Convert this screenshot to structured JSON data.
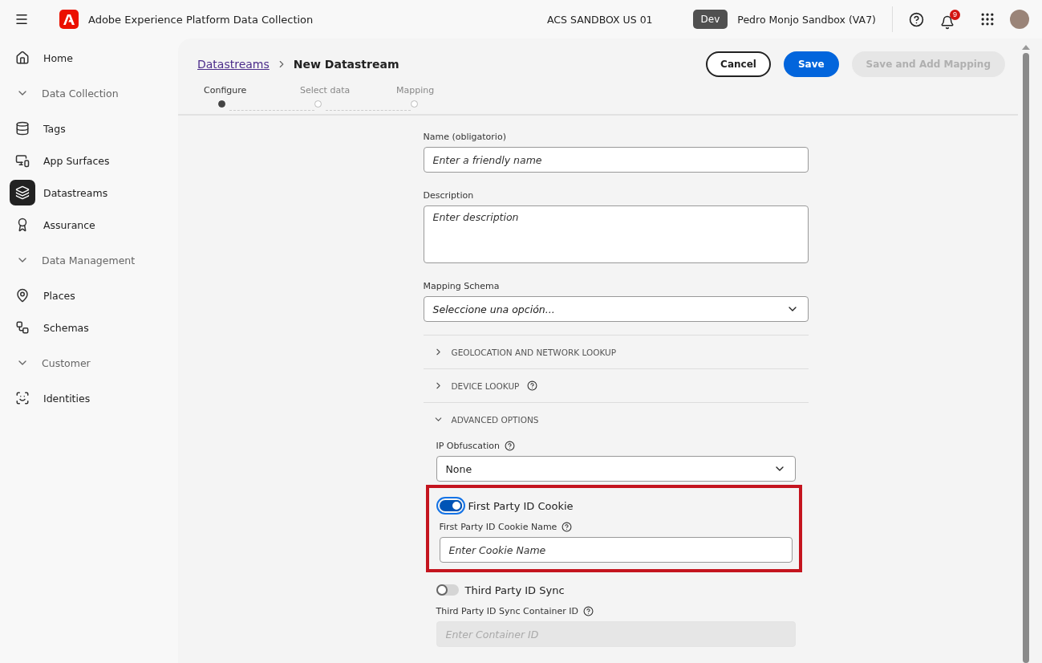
{
  "app_bar": {
    "title": "Adobe Experience Platform Data Collection",
    "org": "ACS SANDBOX US 01",
    "env_badge": "Dev",
    "sandbox": "Pedro Monjo Sandbox (VA7)",
    "notification_count": "9"
  },
  "sidebar": {
    "items": [
      {
        "kind": "item",
        "label": "Home",
        "selected": false
      },
      {
        "kind": "group",
        "label": "Data Collection",
        "expanded": true
      },
      {
        "kind": "item",
        "label": "Tags",
        "selected": false
      },
      {
        "kind": "item",
        "label": "App Surfaces",
        "selected": false
      },
      {
        "kind": "item",
        "label": "Datastreams",
        "selected": true
      },
      {
        "kind": "item",
        "label": "Assurance",
        "selected": false
      },
      {
        "kind": "group",
        "label": "Data Management",
        "expanded": true
      },
      {
        "kind": "item",
        "label": "Places",
        "selected": false
      },
      {
        "kind": "item",
        "label": "Schemas",
        "selected": false
      },
      {
        "kind": "group",
        "label": "Customer",
        "expanded": true
      },
      {
        "kind": "item",
        "label": "Identities",
        "selected": false
      }
    ]
  },
  "breadcrumb": {
    "link": "Datastreams",
    "current": "New Datastream"
  },
  "actions": [
    {
      "label": "Cancel",
      "kind": "secondary",
      "disabled": false
    },
    {
      "label": "Save",
      "kind": "primary",
      "disabled": false
    },
    {
      "label": "Save and Add Mapping",
      "kind": "secondary",
      "disabled": true
    }
  ],
  "steps": [
    {
      "label": "Configure",
      "selected": true
    },
    {
      "label": "Select data",
      "selected": false
    },
    {
      "label": "Mapping",
      "selected": false
    }
  ],
  "form": {
    "name": {
      "label": "Name (obligatorio)",
      "placeholder": "Enter a friendly name"
    },
    "description": {
      "label": "Description",
      "placeholder": "Enter description"
    },
    "mapping_schema": {
      "label": "Mapping Schema",
      "value": "Seleccione una opción..."
    }
  },
  "sections": [
    {
      "title": "GEOLOCATION AND NETWORK LOOKUP",
      "expanded": false,
      "help": false
    },
    {
      "title": "DEVICE LOOKUP",
      "expanded": false,
      "help": true
    },
    {
      "title": "ADVANCED OPTIONS",
      "expanded": true,
      "help": false
    }
  ],
  "advanced": {
    "ip_obfuscation": {
      "label": "IP Obfuscation",
      "value": "None"
    },
    "toggles": [
      {
        "label": "First Party ID Cookie",
        "on": true,
        "highlighted": true,
        "field": {
          "label": "First Party ID Cookie Name",
          "placeholder": "Enter Cookie Name",
          "disabled": false
        }
      },
      {
        "label": "Third Party ID Sync",
        "on": false,
        "highlighted": false,
        "field": {
          "label": "Third Party ID Sync Container ID",
          "placeholder": "Enter Container ID",
          "disabled": true
        }
      }
    ]
  }
}
